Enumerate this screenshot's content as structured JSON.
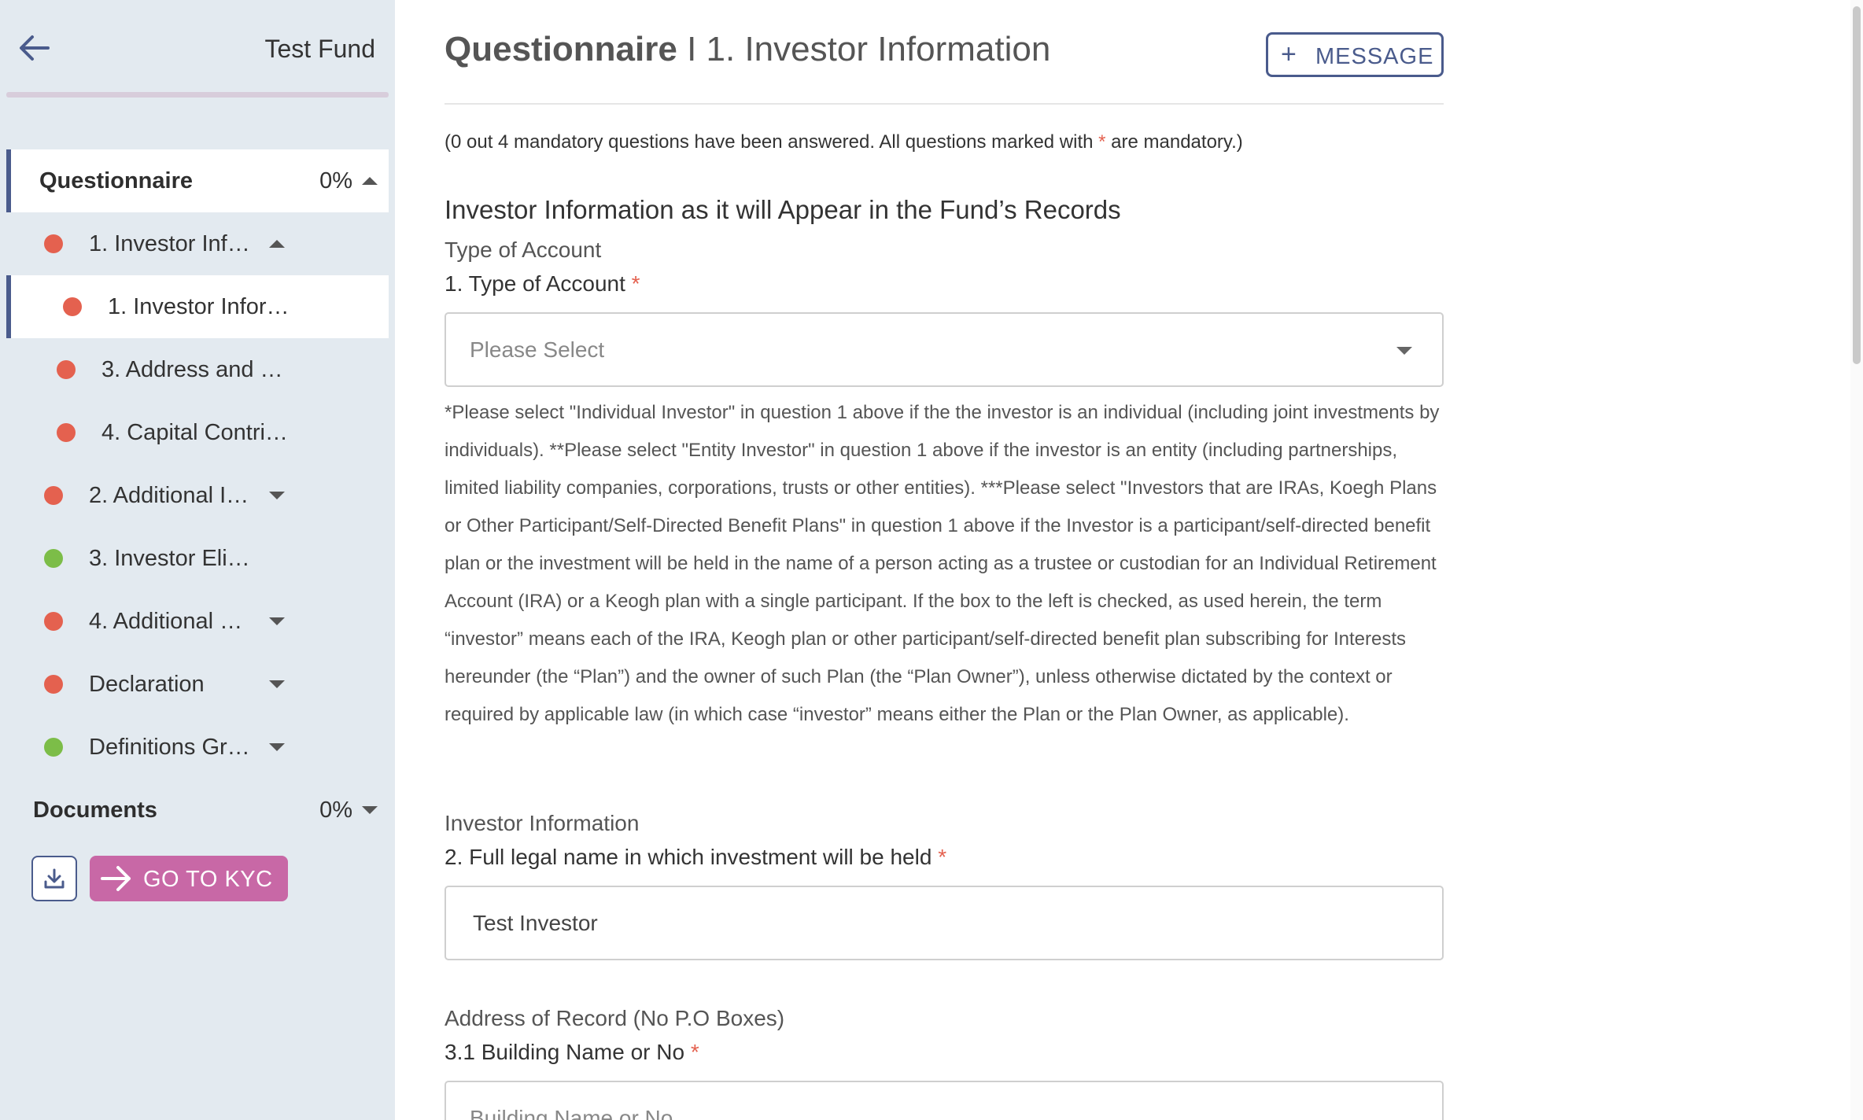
{
  "sidebar": {
    "fund_name": "Test Fund",
    "questionnaire": {
      "label": "Questionnaire",
      "progress": "0%"
    },
    "items": [
      {
        "label": "1. Investor Inf…",
        "status": "red"
      },
      {
        "label": "1. Investor Infor…",
        "status": "red"
      },
      {
        "label": "3. Address and …",
        "status": "red"
      },
      {
        "label": "4. Capital Contri…",
        "status": "red"
      },
      {
        "label": "2. Additional I…",
        "status": "red"
      },
      {
        "label": "3. Investor Eli…",
        "status": "green"
      },
      {
        "label": "4. Additional …",
        "status": "red"
      },
      {
        "label": "Declaration",
        "status": "red"
      },
      {
        "label": "Definitions Gr…",
        "status": "green"
      }
    ],
    "documents": {
      "label": "Documents",
      "progress": "0%"
    },
    "kyc_label": "GO TO KYC"
  },
  "header": {
    "title_bold": "Questionnaire",
    "title_sep": " I ",
    "title_section": "1. Investor Information",
    "message_label": "MESSAGE",
    "message_plus": "+"
  },
  "status": {
    "before": "(0 out 4 mandatory questions have been answered. All questions marked with ",
    "asterisk": "*",
    "after": " are mandatory.)"
  },
  "form": {
    "section_title": "Investor Information as it will Appear in the Fund’s Records",
    "group1": "Type of Account",
    "q1_label": "1. Type of Account",
    "q1_placeholder": "Please Select",
    "help_text": "*Please select \"Individual Investor\" in question 1 above if the the investor is an individual (including joint investments by individuals). **Please select \"Entity Investor\" in question 1 above if the investor is an entity (including partnerships, limited liability companies, corporations, trusts or other entities). ***Please select \"Investors that are IRAs, Koegh Plans or Other Participant/Self-Directed Benefit Plans\" in question 1 above if the Investor is a participant/self-directed benefit plan or the investment will be held in the name of a person acting as a trustee or custodian for an Individual Retirement Account (IRA) or a Keogh plan with a single participant. If the box to the left is checked, as used herein, the term “investor” means each of the IRA, Keogh plan or other participant/self-directed benefit plan subscribing for Interests hereunder (the “Plan”) and the owner of such Plan (the “Plan Owner”), unless otherwise dictated by the context or required by applicable law (in which case “investor” means either the Plan or the Plan Owner, as applicable).",
    "group2": "Investor Information",
    "q2_label": "2. Full legal name in which investment will be held",
    "q2_value": "Test Investor",
    "group3": "Address of Record (No P.O Boxes)",
    "q3_label": "3.1 Building Name or No",
    "q3_placeholder": "Building Name or No",
    "required_mark": "*"
  },
  "colors": {
    "accent": "#4a5b8c",
    "kyc": "#c868a6",
    "status_red": "#e4614f",
    "status_green": "#7cbd48",
    "sidebar_bg": "#e3eaf0"
  }
}
